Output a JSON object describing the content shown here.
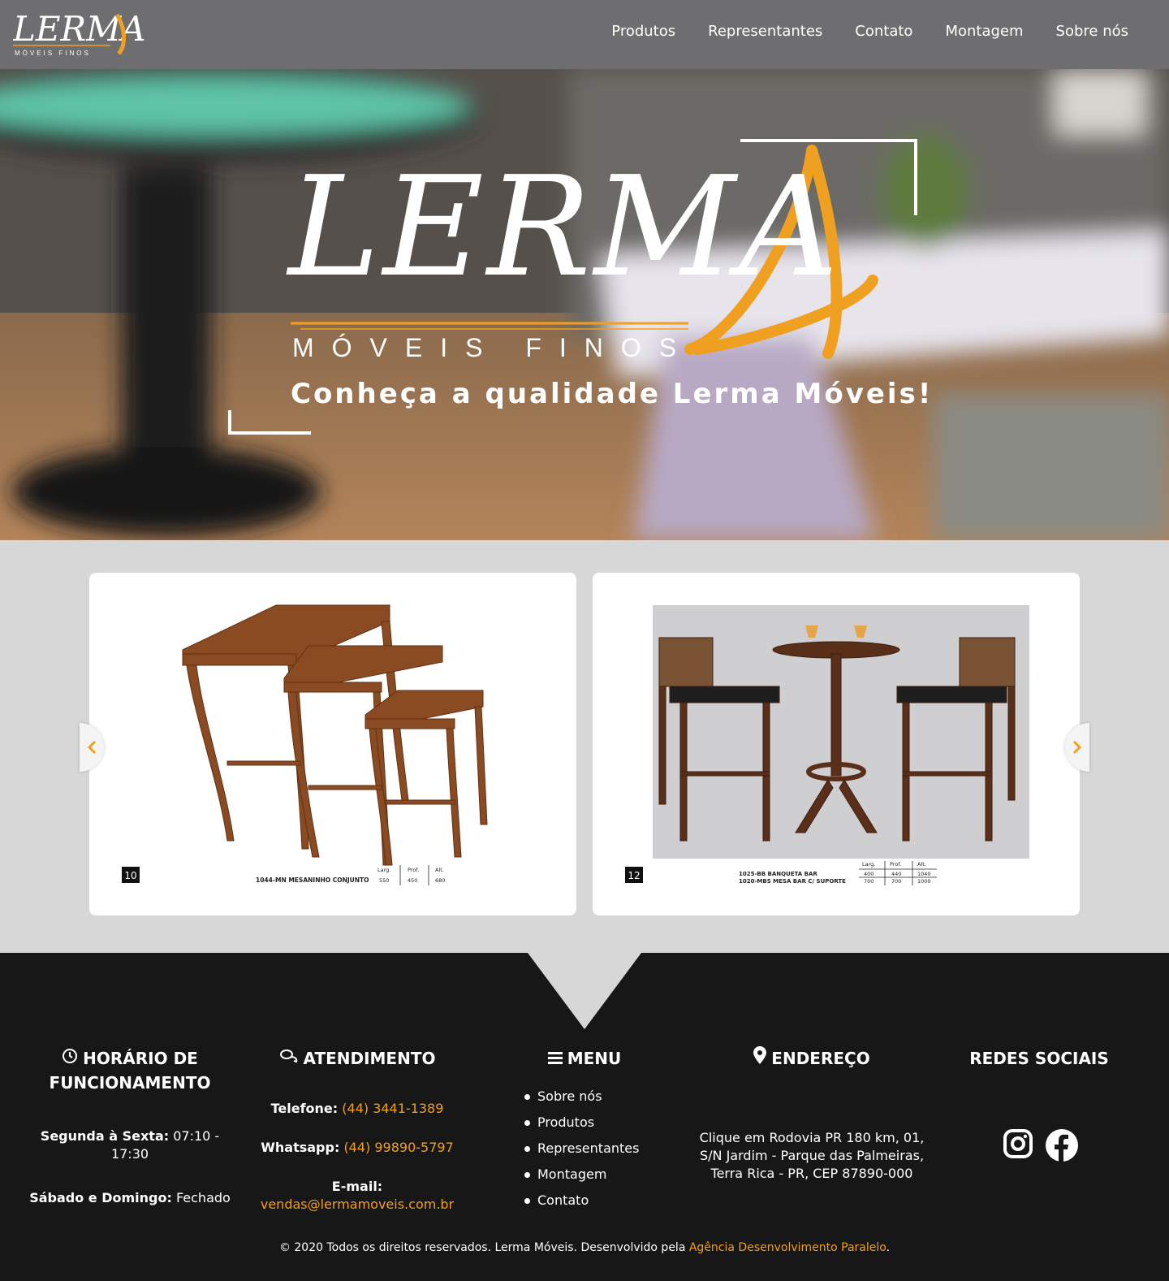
{
  "header": {
    "logo_text": "LERMA",
    "logo_sub": "MÓVEIS FINOS",
    "nav": [
      "Produtos",
      "Representantes",
      "Contato",
      "Montagem",
      "Sobre nós"
    ]
  },
  "hero": {
    "brand": "LERMA",
    "sub": "MÓVEIS FINOS",
    "tagline": "Conheça a qualidade Lerma Móveis!"
  },
  "products": [
    {
      "number": "10",
      "caption": "1044-MN MESANINHO CONJUNTO",
      "dims_header": [
        "Larg.",
        "Prof.",
        "Alt."
      ],
      "dims": [
        "550",
        "450",
        "680"
      ]
    },
    {
      "number": "12",
      "caption_lines": [
        "1025-BB BANQUETA BAR",
        "1020-MBS MESA BAR C/ SUPORTE"
      ],
      "dims_header": [
        "Larg.",
        "Prof.",
        "Alt."
      ],
      "dims_rows": [
        [
          "400",
          "440",
          "1040"
        ],
        [
          "700",
          "700",
          "1000"
        ]
      ]
    }
  ],
  "carousel": {
    "prev_icon": "chevron-left-icon",
    "next_icon": "chevron-right-icon"
  },
  "footer": {
    "horario": {
      "title": "HORÁRIO DE FUNCIONAMENTO",
      "weekday_label": "Segunda à Sexta:",
      "weekday_value": "07:10 - 17:30",
      "weekend_label": "Sábado e Domingo:",
      "weekend_value": "Fechado"
    },
    "atendimento": {
      "title": "ATENDIMENTO",
      "phone_label": "Telefone:",
      "phone": "(44) 3441-1389",
      "whatsapp_label": "Whatsapp:",
      "whatsapp": "(44) 99890-5797",
      "email_label": "E-mail:",
      "email": "vendas@lermamoveis.com.br"
    },
    "menu": {
      "title": "MENU",
      "items": [
        "Sobre nós",
        "Produtos",
        "Representantes",
        "Montagem",
        "Contato"
      ]
    },
    "endereco": {
      "title": "ENDEREÇO",
      "text": "Clique em Rodovia PR 180 km, 01, S/N Jardim - Parque das Palmeiras, Terra Rica - PR, CEP 87890-000"
    },
    "redes": {
      "title": "REDES SOCIAIS",
      "icons": [
        "instagram-icon",
        "facebook-icon"
      ]
    },
    "copyright_prefix": "© 2020 Todos os direitos reservados. Lerma Móveis. Desenvolvido pela ",
    "copyright_link": "Agência Desenvolvimento Paralelo",
    "copyright_suffix": "."
  },
  "colors": {
    "accent": "#f0a020",
    "header_bg": "#6e6e70",
    "footer_bg": "#171717",
    "page_bg": "#d7d7d7"
  }
}
